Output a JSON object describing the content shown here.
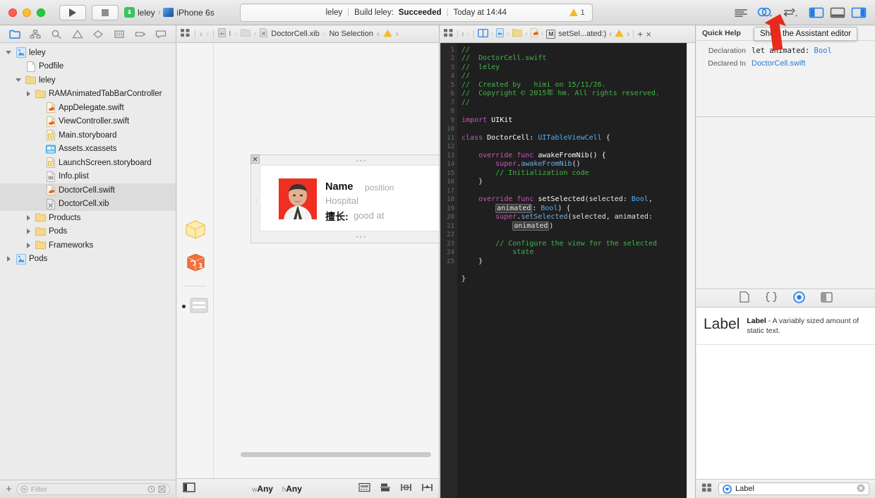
{
  "window": {
    "traffic_lights": [
      "close",
      "minimize",
      "zoom"
    ]
  },
  "toolbar": {
    "run_label": "Run",
    "stop_label": "Stop",
    "scheme_name": "leley",
    "scheme_separator": "›",
    "destination": "iPhone 6s",
    "activity": {
      "project": "leley",
      "sep": "|",
      "build_prefix": "Build leley:",
      "build_status": "Succeeded",
      "timestamp": "Today at 14:44"
    },
    "warning_count": "1",
    "editor_buttons": [
      {
        "name": "standard-editor",
        "label": "Show the Standard editor"
      },
      {
        "name": "assistant-editor",
        "label": "Show the Assistant editor"
      },
      {
        "name": "version-editor",
        "label": "Show the Version editor"
      }
    ],
    "view_buttons": [
      {
        "name": "navigator-toggle",
        "label": "Hide or show the Navigator"
      },
      {
        "name": "debug-toggle",
        "label": "Hide or show the Debug area"
      },
      {
        "name": "utilities-toggle",
        "label": "Hide or show the Utilities"
      }
    ],
    "tooltip": "Show the Assistant editor"
  },
  "navigator": {
    "tabs": [
      {
        "name": "project-navigator",
        "icon": "folder-icon",
        "active": true
      },
      {
        "name": "source-control-navigator",
        "icon": "source-control-icon",
        "active": false
      },
      {
        "name": "symbol-navigator",
        "icon": "search-icon",
        "active": false
      },
      {
        "name": "issue-navigator",
        "icon": "warning-triangle-icon",
        "active": false
      },
      {
        "name": "test-navigator",
        "icon": "diamond-icon",
        "active": false
      },
      {
        "name": "debug-navigator",
        "icon": "gauge-icon",
        "active": false
      },
      {
        "name": "breakpoint-navigator",
        "icon": "tag-icon",
        "active": false
      },
      {
        "name": "report-navigator",
        "icon": "speech-bubble-icon",
        "active": false
      }
    ],
    "tree": [
      {
        "label": "leley",
        "icon": "xcode-project-icon",
        "indent": 0,
        "twisty": "down",
        "selected": false
      },
      {
        "label": "Podfile",
        "icon": "plain-file-icon",
        "indent": 1,
        "twisty": "none",
        "selected": false
      },
      {
        "label": "leley",
        "icon": "folder-icon",
        "indent": 1,
        "twisty": "down",
        "selected": false
      },
      {
        "label": "RAMAnimatedTabBarController",
        "icon": "folder-icon",
        "indent": 2,
        "twisty": "right",
        "selected": false
      },
      {
        "label": "AppDelegate.swift",
        "icon": "swift-file-icon",
        "indent": 3,
        "twisty": "none",
        "selected": false
      },
      {
        "label": "ViewController.swift",
        "icon": "swift-file-icon",
        "indent": 3,
        "twisty": "none",
        "selected": false
      },
      {
        "label": "Main.storyboard",
        "icon": "storyboard-icon",
        "indent": 3,
        "twisty": "none",
        "selected": false
      },
      {
        "label": "Assets.xcassets",
        "icon": "assets-icon",
        "indent": 3,
        "twisty": "none",
        "selected": false
      },
      {
        "label": "LaunchScreen.storyboard",
        "icon": "storyboard-icon",
        "indent": 3,
        "twisty": "none",
        "selected": false
      },
      {
        "label": "Info.plist",
        "icon": "plist-icon",
        "indent": 3,
        "twisty": "none",
        "selected": false
      },
      {
        "label": "DoctorCell.swift",
        "icon": "swift-file-icon",
        "indent": 3,
        "twisty": "none",
        "selected": true
      },
      {
        "label": "DoctorCell.xib",
        "icon": "xib-icon",
        "indent": 3,
        "twisty": "none",
        "selected": true
      },
      {
        "label": "Products",
        "icon": "folder-icon",
        "indent": 2,
        "twisty": "right",
        "selected": false
      },
      {
        "label": "Pods",
        "icon": "folder-icon",
        "indent": 2,
        "twisty": "right",
        "selected": false
      },
      {
        "label": "Frameworks",
        "icon": "folder-icon",
        "indent": 2,
        "twisty": "right",
        "selected": false
      },
      {
        "label": "Pods",
        "icon": "xcode-project-icon",
        "indent": 0,
        "twisty": "right",
        "selected": false
      }
    ],
    "filter_placeholder": "Filter",
    "add_label": "+"
  },
  "ib_editor": {
    "jumpbar": {
      "file": "DoctorCell.xib",
      "selection": "No Selection",
      "sep": "›"
    },
    "outline_items": [
      {
        "name": "placeholders-cube",
        "icon": "yellow-cube-icon"
      },
      {
        "name": "first-responder-cube",
        "icon": "orange-cube-icon"
      },
      {
        "name": "table-view-cell-object",
        "icon": "table-cell-icon"
      }
    ],
    "cell": {
      "name": "Name",
      "position": "position",
      "hospital": "Hospital",
      "goodat_label": "擅长:",
      "goodat_value": "good at",
      "photo_alt": "doctor-photo"
    },
    "bottom_bar": {
      "size_class_w_prefix": "w",
      "size_class_w": "Any",
      "size_class_h_prefix": "h",
      "size_class_h": "Any",
      "buttons": [
        {
          "name": "document-outline-toggle",
          "icon": "outline-panel-icon"
        },
        {
          "name": "update-frames-button",
          "icon": "update-frames-icon"
        },
        {
          "name": "align-button",
          "icon": "align-icon"
        },
        {
          "name": "pin-button",
          "icon": "pin-icon"
        },
        {
          "name": "resolve-issues-button",
          "icon": "resolve-issues-icon"
        }
      ]
    }
  },
  "code_editor": {
    "jumpbar": {
      "symbol": "setSel...ated:)",
      "symbol_badge": "M",
      "add_label": "+",
      "close_label": "×"
    },
    "filename": "DoctorCell.swift",
    "first_line": 1,
    "last_line": 25,
    "lines": [
      {
        "n": 1,
        "segs": [
          {
            "t": "//",
            "c": "cm"
          }
        ]
      },
      {
        "n": 2,
        "segs": [
          {
            "t": "//  DoctorCell.swift",
            "c": "cm"
          }
        ]
      },
      {
        "n": 3,
        "segs": [
          {
            "t": "//  leley",
            "c": "cm"
          }
        ]
      },
      {
        "n": 4,
        "segs": [
          {
            "t": "//",
            "c": "cm"
          }
        ]
      },
      {
        "n": 5,
        "segs": [
          {
            "t": "//  Created by   himi on 15/11/26.",
            "c": "cm"
          }
        ]
      },
      {
        "n": 6,
        "segs": [
          {
            "t": "//  Copyright © 2015年 hm. All rights reserved.",
            "c": "cm"
          }
        ]
      },
      {
        "n": 7,
        "segs": [
          {
            "t": "//",
            "c": "cm"
          }
        ]
      },
      {
        "n": 8,
        "segs": [
          {
            "t": "",
            "c": ""
          }
        ]
      },
      {
        "n": 9,
        "segs": [
          {
            "t": "import ",
            "c": "kw"
          },
          {
            "t": "UIKit",
            "c": "id"
          }
        ]
      },
      {
        "n": 10,
        "segs": [
          {
            "t": "",
            "c": ""
          }
        ]
      },
      {
        "n": 11,
        "segs": [
          {
            "t": "class ",
            "c": "kw"
          },
          {
            "t": "DoctorCell",
            "c": "id"
          },
          {
            "t": ": ",
            "c": ""
          },
          {
            "t": "UITableViewCell",
            "c": "ty"
          },
          {
            "t": " {",
            "c": ""
          }
        ]
      },
      {
        "n": 12,
        "segs": [
          {
            "t": "",
            "c": ""
          }
        ]
      },
      {
        "n": 13,
        "segs": [
          {
            "t": "    override func ",
            "c": "kw"
          },
          {
            "t": "awakeFromNib() {",
            "c": "id"
          }
        ]
      },
      {
        "n": 14,
        "segs": [
          {
            "t": "        super",
            "c": "kw"
          },
          {
            "t": ".",
            "c": ""
          },
          {
            "t": "awakeFromNib",
            "c": "fn"
          },
          {
            "t": "()",
            "c": ""
          }
        ]
      },
      {
        "n": 15,
        "segs": [
          {
            "t": "        // Initialization code",
            "c": "cm"
          }
        ]
      },
      {
        "n": 16,
        "segs": [
          {
            "t": "    }",
            "c": ""
          }
        ]
      },
      {
        "n": 17,
        "segs": [
          {
            "t": "",
            "c": ""
          }
        ]
      },
      {
        "n": 18,
        "segs": [
          {
            "t": "    override func ",
            "c": "kw"
          },
          {
            "t": "setSelected",
            "c": "id"
          },
          {
            "t": "(selected: ",
            "c": ""
          },
          {
            "t": "Bool",
            "c": "ty"
          },
          {
            "t": ",",
            "c": ""
          }
        ]
      },
      {
        "n": 0,
        "segs": [
          {
            "t": "        ",
            "c": ""
          },
          {
            "t": "animated",
            "c": "tok"
          },
          {
            "t": ": ",
            "c": ""
          },
          {
            "t": "Bool",
            "c": "ty"
          },
          {
            "t": ") {",
            "c": ""
          }
        ]
      },
      {
        "n": 19,
        "segs": [
          {
            "t": "        super",
            "c": "kw"
          },
          {
            "t": ".",
            "c": ""
          },
          {
            "t": "setSelected",
            "c": "fn"
          },
          {
            "t": "(selected, animated:",
            "c": ""
          }
        ]
      },
      {
        "n": 0,
        "segs": [
          {
            "t": "            ",
            "c": ""
          },
          {
            "t": "animated",
            "c": "tok"
          },
          {
            "t": ")",
            "c": ""
          }
        ]
      },
      {
        "n": 20,
        "segs": [
          {
            "t": "",
            "c": ""
          }
        ]
      },
      {
        "n": 21,
        "segs": [
          {
            "t": "        // Configure the view for the selected",
            "c": "cm"
          }
        ]
      },
      {
        "n": 0,
        "segs": [
          {
            "t": "            state",
            "c": "cm"
          }
        ]
      },
      {
        "n": 22,
        "segs": [
          {
            "t": "    }",
            "c": ""
          }
        ]
      },
      {
        "n": 23,
        "segs": [
          {
            "t": "",
            "c": ""
          }
        ]
      },
      {
        "n": 24,
        "segs": [
          {
            "t": "}",
            "c": ""
          }
        ]
      },
      {
        "n": 25,
        "segs": [
          {
            "t": "",
            "c": ""
          }
        ]
      }
    ]
  },
  "utilities": {
    "quick_help": {
      "title": "Quick Help",
      "rows": [
        {
          "label": "Declaration",
          "value": "let animated: ",
          "type": "Bool",
          "is_link": false
        },
        {
          "label": "Declared In",
          "value": "DoctorCell.swift",
          "type": "",
          "is_link": true
        }
      ]
    },
    "library_tabs": [
      {
        "name": "file-template-library",
        "icon": "document-icon",
        "active": false
      },
      {
        "name": "code-snippet-library",
        "icon": "braces-icon",
        "active": false
      },
      {
        "name": "object-library",
        "icon": "circle-target-icon",
        "active": true
      },
      {
        "name": "media-library",
        "icon": "media-panel-icon",
        "active": false
      }
    ],
    "library_items": [
      {
        "preview": "Label",
        "title": "Label",
        "dash": " - ",
        "description": "A variably sized amount of static text."
      }
    ],
    "filter_value": "Label",
    "filter_placeholder": "Filter",
    "clear_label": "×"
  },
  "colors": {
    "accent_blue": "#1e7ce8",
    "warning_yellow": "#f5ba2a",
    "code_bg": "#1f1f20",
    "comment_green": "#41b645",
    "keyword_magenta": "#c957b4",
    "type_blue": "#54b1f6",
    "arrow_red": "#e8291c",
    "photo_red": "#ee2f22"
  }
}
